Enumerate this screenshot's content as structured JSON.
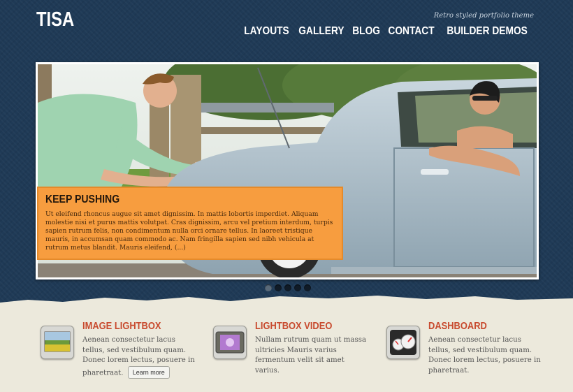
{
  "site": {
    "logo": "TISA",
    "tagline": "Retro styled portfolio theme"
  },
  "nav": [
    {
      "label": "LAYOUTS"
    },
    {
      "label": "GALLERY"
    },
    {
      "label": "BLOG"
    },
    {
      "label": "CONTACT"
    },
    {
      "label": "BUILDER DEMOS"
    }
  ],
  "slider": {
    "image_icon": "photo-of-couple-with-car",
    "caption_title": "KEEP PUSHING",
    "caption_text": "Ut eleifend rhoncus augue sit amet dignissim. In mattis lobortis imperdiet. Aliquam molestie nisi et purus mattis volutpat. Cras dignissim, arcu vel pretium interdum, turpis sapien rutrum felis, non condimentum nulla orci ornare tellus. In laoreet tristique mauris, in accumsan quam commodo ac. Nam fringilla sapien sed nibh vehicula at rutrum metus blandit. Mauris eleifend, (...)",
    "slide_count": 5,
    "active_slide": 1
  },
  "features": [
    {
      "icon": "image-lightbox-icon",
      "title": "IMAGE LIGHTBOX",
      "text": "Aenean consectetur lacus tellus, sed vestibulum quam. Donec lorem lectus, posuere in pharetraat.",
      "button": "Learn more"
    },
    {
      "icon": "lightbox-video-icon",
      "title": "LIGHTBOX VIDEO",
      "text": "Nullam rutrum quam ut massa ultricies Mauris varius fermentum velit sit amet varius."
    },
    {
      "icon": "dashboard-gauge-icon",
      "title": "DASHBOARD",
      "text": "Aenean consectetur lacus tellus, sed vestibulum quam. Donec lorem lectus, posuere in pharetraat."
    }
  ],
  "colors": {
    "header_bg": "#1f3a56",
    "caption_bg": "#f79d3f",
    "feature_title": "#c84a2e",
    "footer_bg": "#ece9dc"
  }
}
